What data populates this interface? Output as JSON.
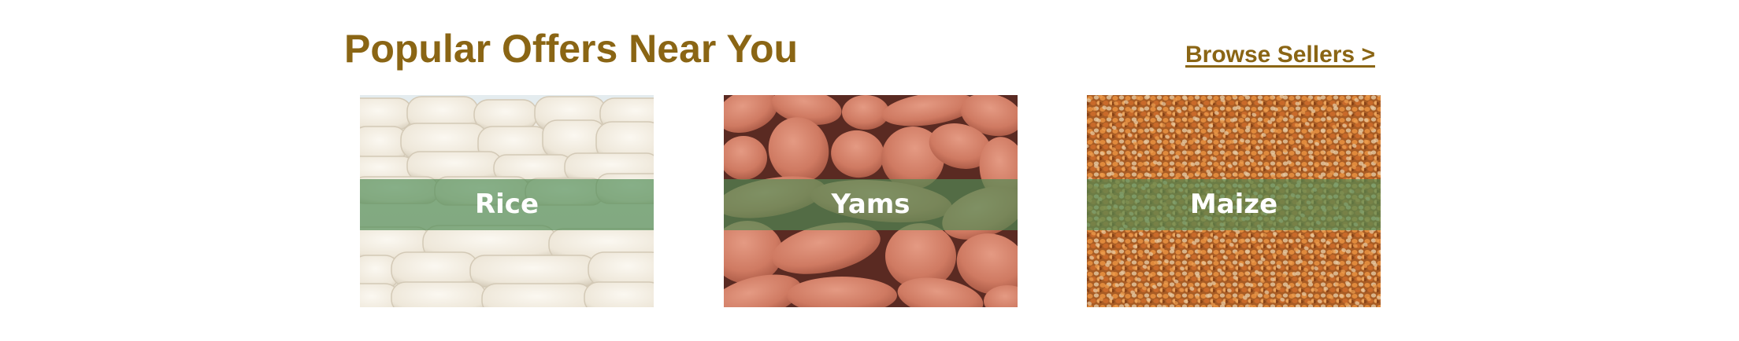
{
  "section": {
    "title": "Popular Offers Near You",
    "browse_link": "Browse Sellers >",
    "title_color": "#8a6514"
  },
  "offers": [
    {
      "label": "Rice",
      "image": "sacks-of-rice-photo"
    },
    {
      "label": "Yams",
      "image": "sweet-potato-yams-photo"
    },
    {
      "label": "Maize",
      "image": "maize-kernels-photo"
    }
  ],
  "colors": {
    "band": "#508c55",
    "label_text": "#ffffff"
  }
}
